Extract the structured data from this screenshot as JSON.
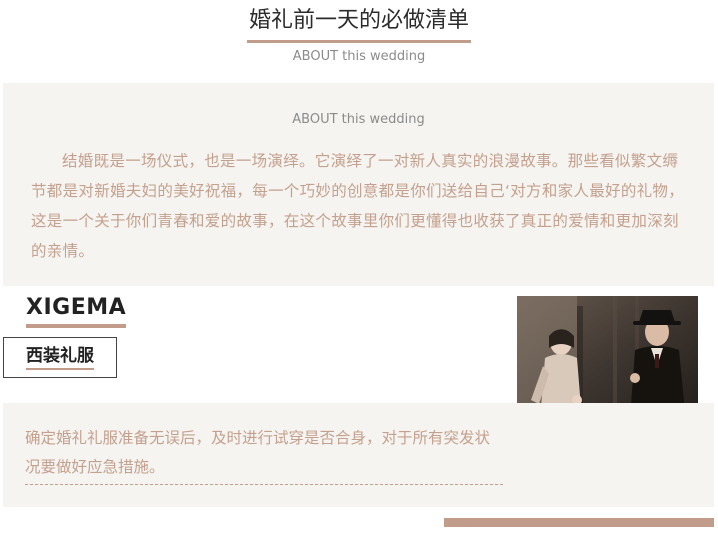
{
  "header": {
    "title": "婚礼前一天的必做清单",
    "subtitle": "ABOUT this wedding"
  },
  "intro": {
    "subtitle": "ABOUT this wedding",
    "body": "结婚既是一场仪式，也是一场演绎。它演绎了一对新人真实的浪漫故事。那些看似繁文缛节都是对新婚夫妇的美好祝福，每一个巧妙的创意都是你们送给自己‘对方和家人最好的礼物，这是一个关于你们青春和爱的故事，在这个故事里你们更懂得也收获了真正的爱情和更加深刻的亲情。"
  },
  "section": {
    "brand": "XIGEMA",
    "tag_label": "西装礼服",
    "body": "确定婚礼礼服准备无误后，及时进行试穿是否合身，对于所有突发状况要做好应急措施。"
  },
  "colors": {
    "accent": "#c29c8b",
    "text_soft": "#c4a08e",
    "panel_bg": "#f6f4f0"
  }
}
